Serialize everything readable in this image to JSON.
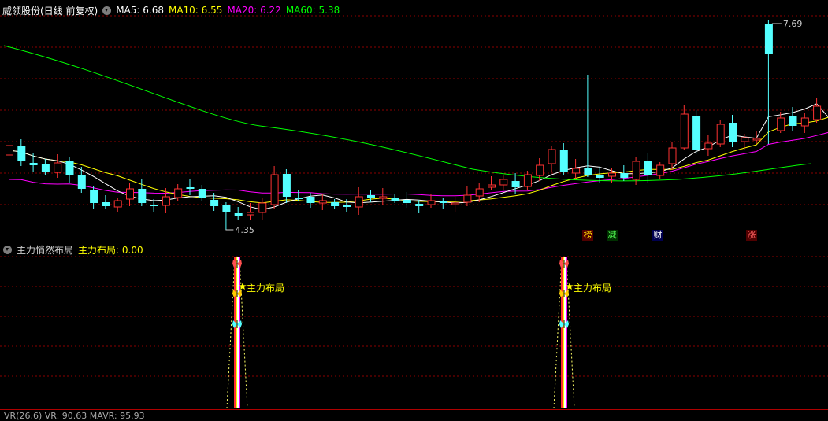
{
  "main_header": {
    "stock": "威领股份(日线 前复权)",
    "ma5_label": "MA5: 6.68",
    "ma10_label": "MA10: 6.55",
    "ma20_label": "MA20: 6.22",
    "ma60_label": "MA60: 5.38"
  },
  "colors": {
    "up": "#ff3232",
    "down": "#54ffff",
    "ma5": "#ffffff",
    "ma10": "#ffff00",
    "ma20": "#ff00ff",
    "ma60": "#00ff00",
    "grid": "#8b0000",
    "divider": "#b00000"
  },
  "price_annotations": {
    "high": "7.69",
    "low": "4.35"
  },
  "event_tags": [
    {
      "text": "榜",
      "color": "#ffdd00",
      "bg": "#500000"
    },
    {
      "text": "减",
      "color": "#54ff54",
      "bg": "#003000"
    },
    {
      "text": "财",
      "color": "#ffffff",
      "bg": "#000050"
    },
    {
      "text": "涨",
      "color": "#ff6060",
      "bg": "#500000"
    }
  ],
  "indicator_header": {
    "name": "主力悄然布局",
    "value_label": "主力布局: 0.00"
  },
  "indicator_signals": {
    "label": "主力布局"
  },
  "bottom_header": {
    "text": "VR(26,6) VR: 90.63 MAVR: 95.93"
  },
  "icons": [
    "dropdown-circle-icon",
    "butterfly-icon",
    "star-icon"
  ]
}
